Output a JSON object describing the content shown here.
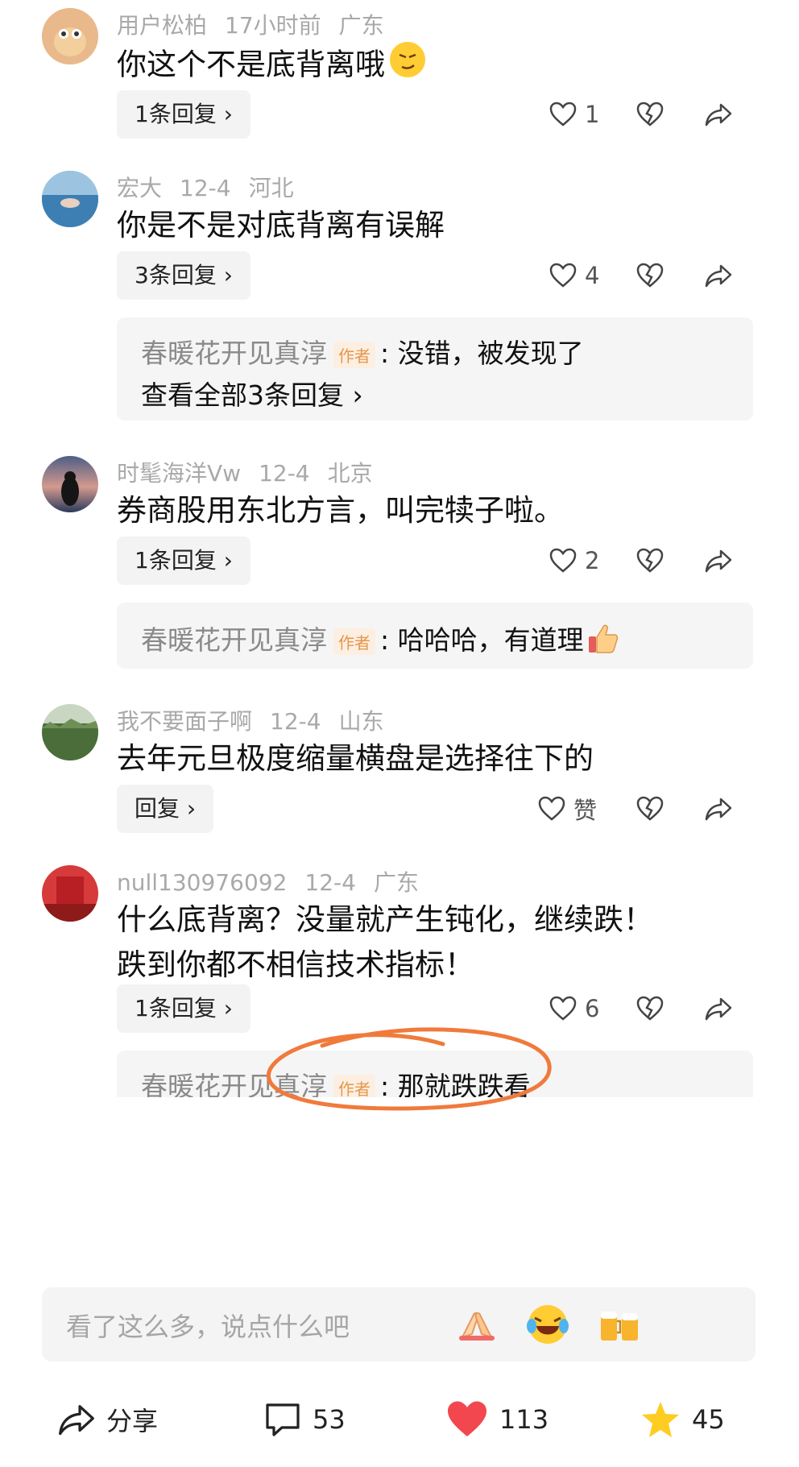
{
  "comments": [
    {
      "user": "用户松柏",
      "time": "17小时前",
      "location": "广东",
      "text": "你这个不是底背离哦",
      "reply_label": "1条回复 ›",
      "likes": "1"
    },
    {
      "user": "宏大",
      "time": "12-4",
      "location": "河北",
      "text": "你是不是对底背离有误解",
      "reply_label": "3条回复 ›",
      "likes": "4",
      "sub": {
        "name": "春暖花开见真淳",
        "tag": "作者",
        "text": "没错，被发现了",
        "view_all": "查看全部3条回复 ›"
      }
    },
    {
      "user": "时髦海洋Vw",
      "time": "12-4",
      "location": "北京",
      "text": "券商股用东北方言，叫完犊子啦。",
      "reply_label": "1条回复 ›",
      "likes": "2",
      "sub": {
        "name": "春暖花开见真淳",
        "tag": "作者",
        "text": "哈哈哈，有道理"
      }
    },
    {
      "user": "我不要面子啊",
      "time": "12-4",
      "location": "山东",
      "text": "去年元旦极度缩量横盘是选择往下的",
      "reply_label": "回复 ›",
      "likes": "赞"
    },
    {
      "user": "null130976092",
      "time": "12-4",
      "location": "广东",
      "text": "什么底背离？没量就产生钝化，继续跌！跌到你都不相信技术指标！",
      "reply_label": "1条回复 ›",
      "likes": "6",
      "sub": {
        "name": "春暖花开见真淳",
        "tag": "作者",
        "text": "那就跌跌看"
      }
    }
  ],
  "input": {
    "placeholder": "看了这么多，说点什么吧"
  },
  "bottom": {
    "share": "分享",
    "comments": "53",
    "likes": "113",
    "stars": "45"
  },
  "colors": {
    "like_red": "#f2474f",
    "star_yellow": "#ffcc22",
    "annotation_orange": "#f07a3c",
    "author_tag": "#e6964a"
  }
}
